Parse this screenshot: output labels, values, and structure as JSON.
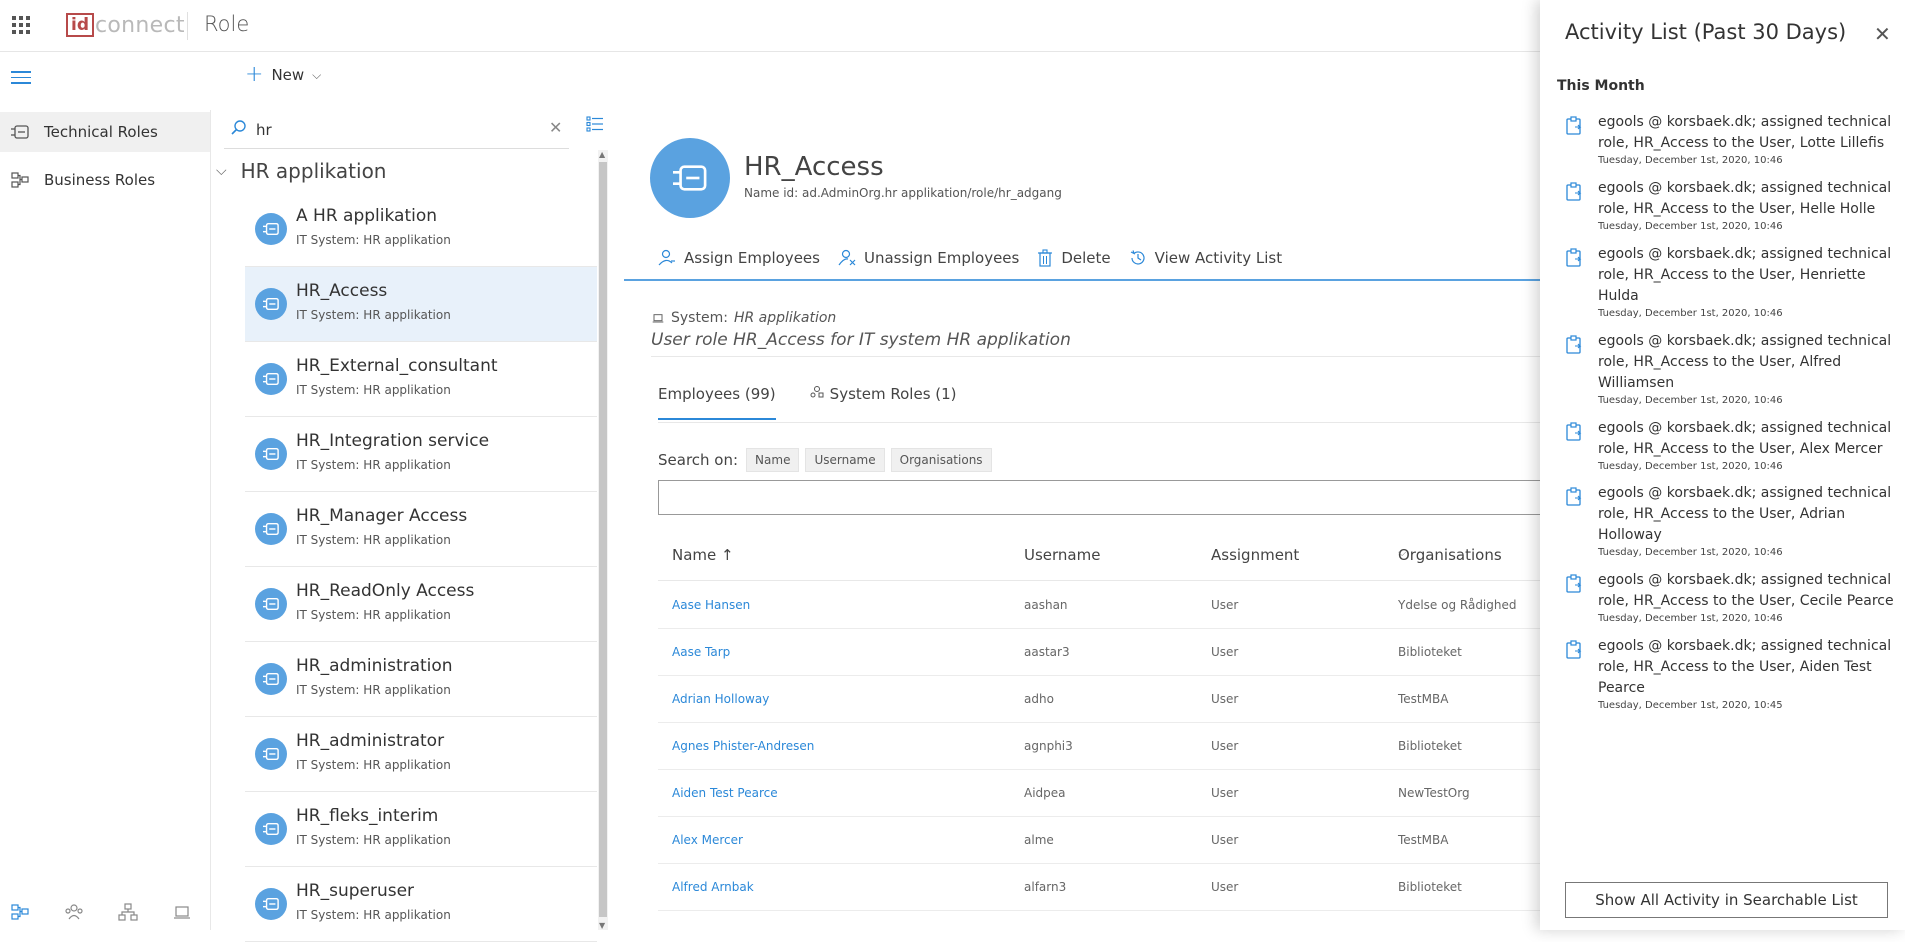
{
  "app": {
    "logo_box": "id",
    "logo_text": "connect",
    "title": "Role"
  },
  "command": {
    "new_label": "New"
  },
  "nav": {
    "items": [
      {
        "label": "Technical Roles",
        "active": true
      },
      {
        "label": "Business Roles",
        "active": false
      }
    ]
  },
  "search": {
    "value": "hr"
  },
  "group": {
    "label": "HR applikation"
  },
  "roles": [
    {
      "name": "A HR applikation",
      "sub": "IT System: HR applikation"
    },
    {
      "name": "HR_Access",
      "sub": "IT System: HR applikation",
      "selected": true
    },
    {
      "name": "HR_External_consultant",
      "sub": "IT System: HR applikation"
    },
    {
      "name": "HR_Integration service",
      "sub": "IT System: HR applikation"
    },
    {
      "name": "HR_Manager Access",
      "sub": "IT System: HR applikation"
    },
    {
      "name": "HR_ReadOnly Access",
      "sub": "IT System: HR applikation"
    },
    {
      "name": "HR_administration",
      "sub": "IT System: HR applikation"
    },
    {
      "name": "HR_administrator",
      "sub": "IT System: HR applikation"
    },
    {
      "name": "HR_fleks_interim",
      "sub": "IT System: HR applikation"
    },
    {
      "name": "HR_superuser",
      "sub": "IT System: HR applikation"
    }
  ],
  "detail": {
    "title": "HR_Access",
    "name_id": "Name id:  ad.AdminOrg.hr applikation/role/hr_adgang",
    "commands": [
      "Assign Employees",
      "Unassign Employees",
      "Delete",
      "View Activity List"
    ],
    "system_label": "System:",
    "system_value": "HR applikation",
    "description": "User role HR_Access for IT system HR applikation",
    "tabs": [
      "Employees (99)",
      "System Roles (1)"
    ],
    "search_on_label": "Search on:",
    "search_chips": [
      "Name",
      "Username",
      "Organisations"
    ],
    "columns": [
      "Name ↑",
      "Username",
      "Assignment",
      "Organisations"
    ],
    "rows": [
      {
        "name": "Aase Hansen",
        "username": "aashan",
        "assignment": "User",
        "org": "Ydelse og Rådighed"
      },
      {
        "name": "Aase Tarp",
        "username": "aastar3",
        "assignment": "User",
        "org": "Biblioteket"
      },
      {
        "name": "Adrian Holloway",
        "username": "adho",
        "assignment": "User",
        "org": "TestMBA"
      },
      {
        "name": "Agnes Phister-Andresen",
        "username": "agnphi3",
        "assignment": "User",
        "org": "Biblioteket"
      },
      {
        "name": "Aiden Test Pearce",
        "username": "Aidpea",
        "assignment": "User",
        "org": "NewTestOrg"
      },
      {
        "name": "Alex Mercer",
        "username": "alme",
        "assignment": "User",
        "org": "TestMBA"
      },
      {
        "name": "Alfred Arnbak",
        "username": "alfarn3",
        "assignment": "User",
        "org": "Biblioteket"
      }
    ]
  },
  "activity": {
    "title": "Activity List (Past 30 Days)",
    "month": "This Month",
    "items": [
      {
        "text": "egools @ korsbaek.dk; assigned technical role, HR_Access to the User, Lotte Lillefis",
        "time": "Tuesday, December 1st, 2020, 10:46"
      },
      {
        "text": "egools @ korsbaek.dk; assigned technical role, HR_Access to the User, Helle Holle",
        "time": "Tuesday, December 1st, 2020, 10:46"
      },
      {
        "text": "egools @ korsbaek.dk; assigned technical role, HR_Access to the User, Henriette Hulda",
        "time": "Tuesday, December 1st, 2020, 10:46"
      },
      {
        "text": "egools @ korsbaek.dk; assigned technical role, HR_Access to the User, Alfred Williamsen",
        "time": "Tuesday, December 1st, 2020, 10:46"
      },
      {
        "text": "egools @ korsbaek.dk; assigned technical role, HR_Access to the User, Alex Mercer",
        "time": "Tuesday, December 1st, 2020, 10:46"
      },
      {
        "text": "egools @ korsbaek.dk; assigned technical role, HR_Access to the User, Adrian Holloway",
        "time": "Tuesday, December 1st, 2020, 10:46"
      },
      {
        "text": "egools @ korsbaek.dk; assigned technical role, HR_Access to the User, Cecile Pearce",
        "time": "Tuesday, December 1st, 2020, 10:46"
      },
      {
        "text": "egools @ korsbaek.dk; assigned technical role, HR_Access to the User, Aiden Test Pearce",
        "time": "Tuesday, December 1st, 2020, 10:45"
      }
    ],
    "show_all_label": "Show All Activity in Searchable List"
  },
  "colors": {
    "accent": "#2b88d8",
    "avatar": "#5aa2e0",
    "logo": "#b74a4a"
  }
}
